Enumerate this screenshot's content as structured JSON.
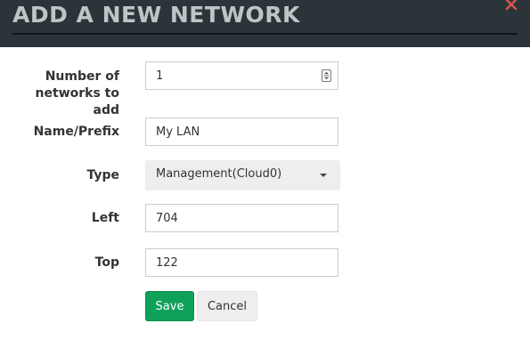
{
  "dialog": {
    "title": "ADD A NEW NETWORK"
  },
  "form": {
    "count_label_line1": "Number of",
    "count_label_line2": "networks to add",
    "count_value": "1",
    "name_label": "Name/Prefix",
    "name_value": "My LAN",
    "type_label": "Type",
    "type_value": "Management(Cloud0)",
    "left_label": "Left",
    "left_value": "704",
    "top_label": "Top",
    "top_value": "122"
  },
  "buttons": {
    "save_label": "Save",
    "cancel_label": "Cancel"
  },
  "colors": {
    "header_bg": "#2b3539",
    "title_text": "#bfc4c7",
    "close_icon": "#d9534f",
    "save_bg": "#0fa15a"
  }
}
